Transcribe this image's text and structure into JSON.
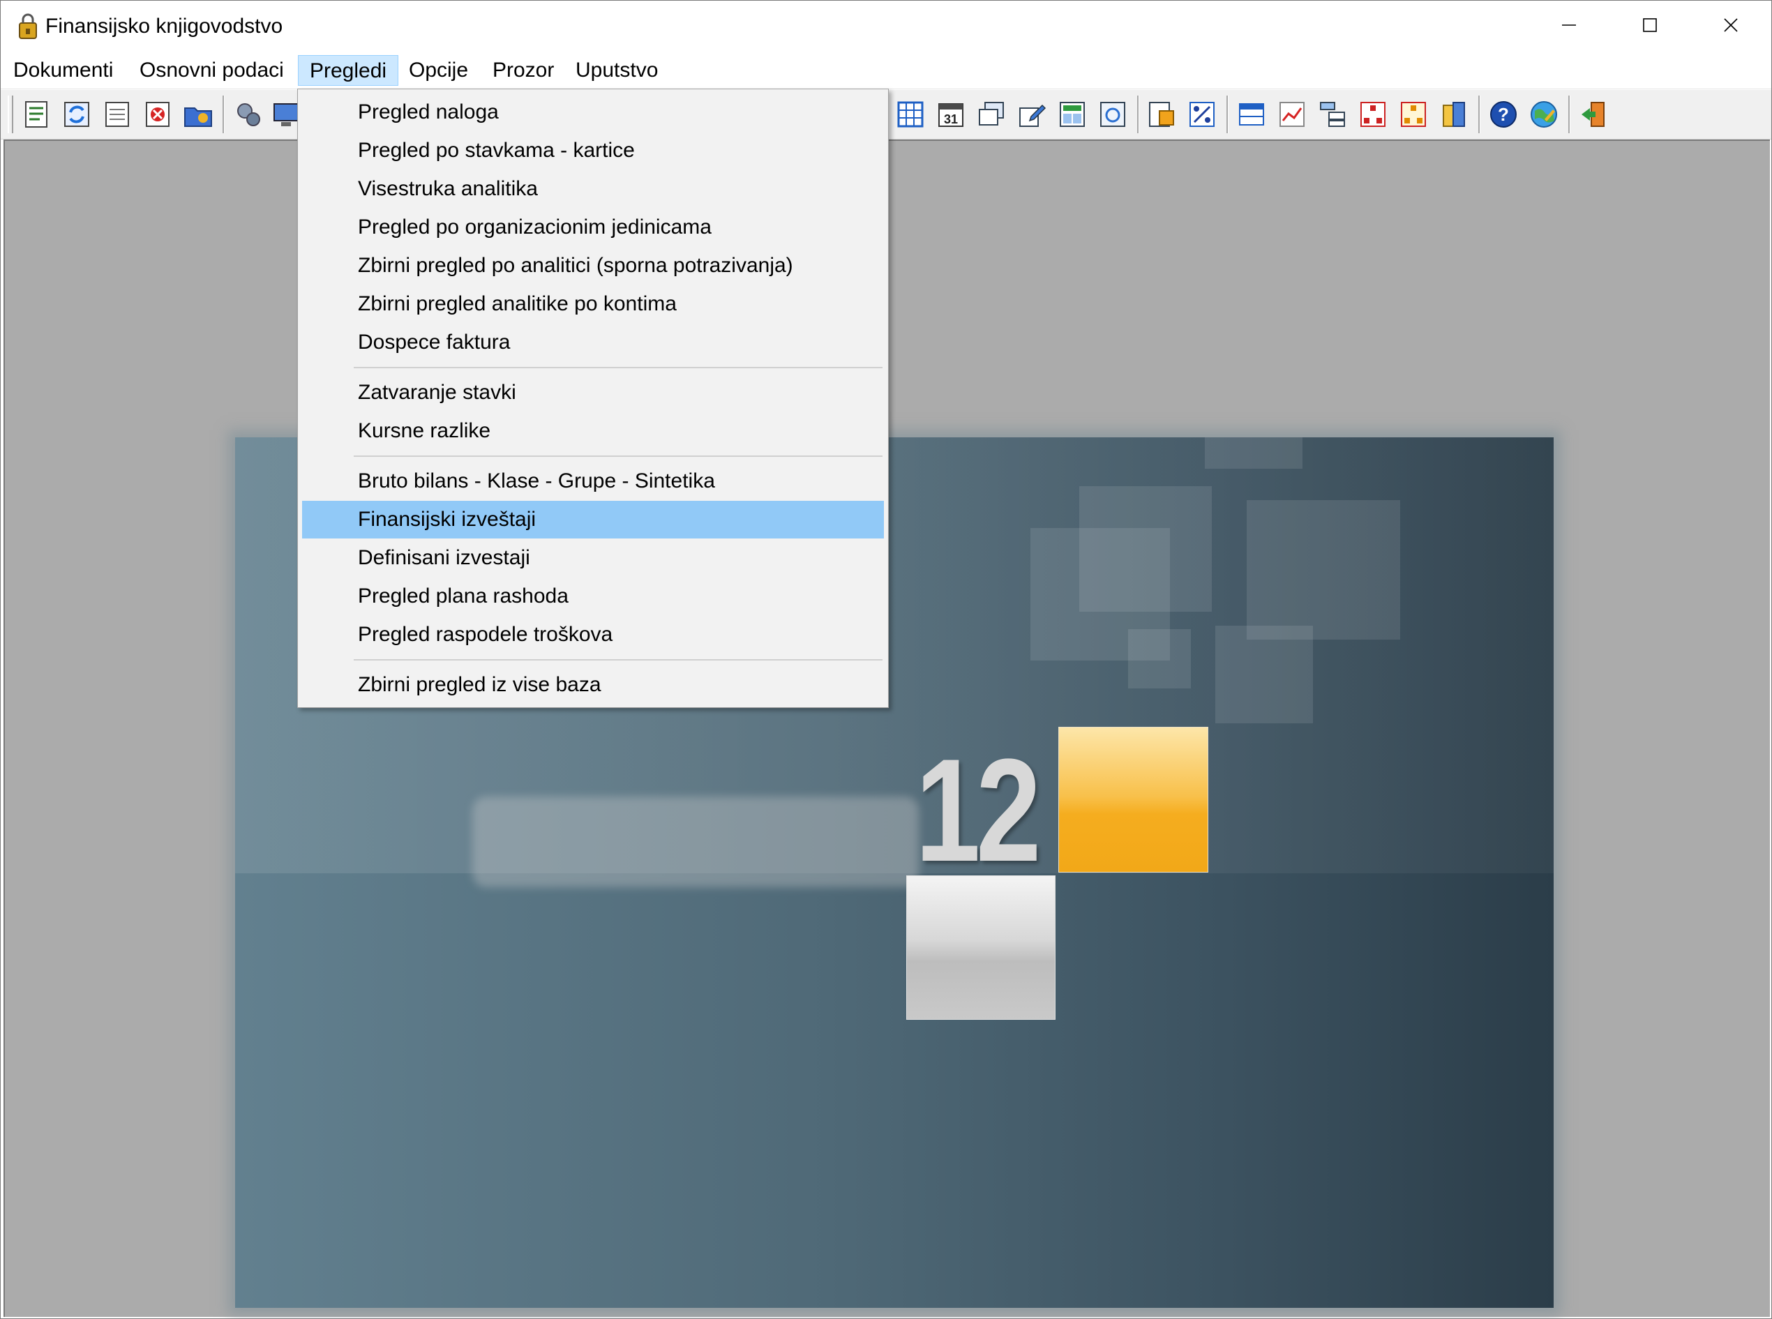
{
  "window": {
    "title": "Finansijsko knjigovodstvo",
    "icon": "app-lock-icon",
    "controls": [
      "minimize-icon",
      "maximize-icon",
      "close-icon"
    ]
  },
  "menubar": {
    "items": [
      {
        "label": "Dokumenti"
      },
      {
        "label": "Osnovni podaci"
      },
      {
        "label": "Pregledi",
        "active": true
      },
      {
        "label": "Opcije"
      },
      {
        "label": "Prozor"
      },
      {
        "label": "Uputstvo"
      }
    ]
  },
  "toolbar": {
    "icons": [
      "document-list-icon",
      "refresh-icon",
      "ledger-icon",
      "delete-document-icon",
      "folder-gear-icon",
      "settings-gear-icon",
      "monitor-icon",
      "table-icon",
      "calendar-icon",
      "windows-icon",
      "edit-icon",
      "grid-report-icon",
      "chart-view-icon",
      "report-export-icon",
      "percent-icon",
      "columns-icon",
      "line-chart-icon",
      "tree-icon",
      "org-chart-icon",
      "org-chart-alt-icon",
      "database-icon",
      "help-icon",
      "globe-icon",
      "exit-icon"
    ]
  },
  "splash": {
    "number": "12"
  },
  "dropdown": {
    "items": [
      {
        "label": "Pregled naloga"
      },
      {
        "label": "Pregled po stavkama - kartice"
      },
      {
        "label": "Visestruka analitika"
      },
      {
        "label": "Pregled po organizacionim jedinicama"
      },
      {
        "label": "Zbirni pregled po analitici (sporna potrazivanja)"
      },
      {
        "label": "Zbirni pregled analitike po kontima"
      },
      {
        "label": "Dospece faktura"
      },
      {
        "label": "Zatvaranje stavki"
      },
      {
        "label": "Kursne razlike"
      },
      {
        "label": "Bruto bilans - Klase - Grupe - Sintetika"
      },
      {
        "label": "Finansijski izveštaji",
        "highlighted": true
      },
      {
        "label": "Definisani izvestaji"
      },
      {
        "label": "Pregled plana rashoda"
      },
      {
        "label": "Pregled raspodele troškova"
      },
      {
        "label": "Zbirni pregled iz vise baza"
      }
    ]
  },
  "colors": {
    "menu_active_bg": "#cce8ff",
    "dropdown_highlight": "#91c9f7",
    "workspace_bg": "#ababab",
    "accent_orange": "#f5ad1f"
  }
}
